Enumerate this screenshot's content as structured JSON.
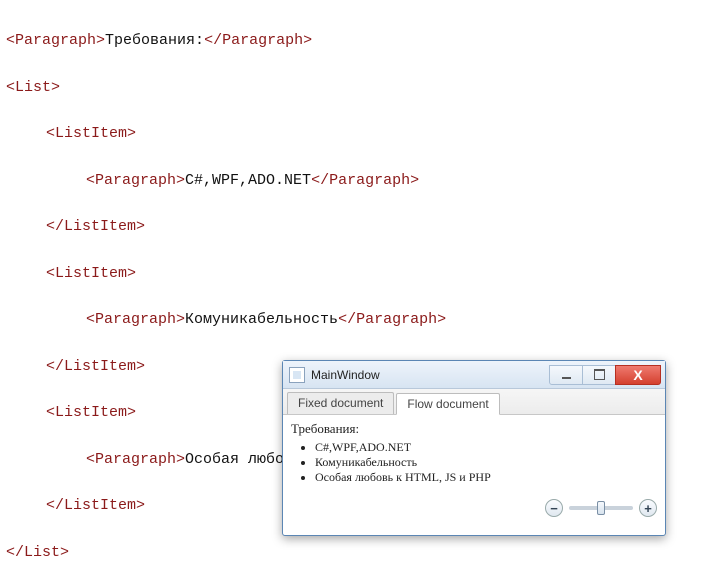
{
  "code": {
    "paragraph_open": "<Paragraph>",
    "paragraph_close": "</Paragraph>",
    "list_open": "<List>",
    "list_close": "</List>",
    "listitem_open": "<ListItem>",
    "listitem_close": "</ListItem>",
    "title_text": "Требования:",
    "items": [
      "C#,WPF,ADO.NET",
      "Комуникабельность",
      "Особая любовь к HTML, JS и PHP"
    ]
  },
  "window": {
    "title": "MainWindow",
    "tabs": {
      "fixed": "Fixed document",
      "flow": "Flow document"
    },
    "req_title": "Требования:",
    "req_items": [
      "C#,WPF,ADO.NET",
      "Комуникабельность",
      "Особая любовь к HTML, JS и PHP"
    ],
    "zoom": {
      "minus": "−",
      "plus": "+"
    }
  }
}
